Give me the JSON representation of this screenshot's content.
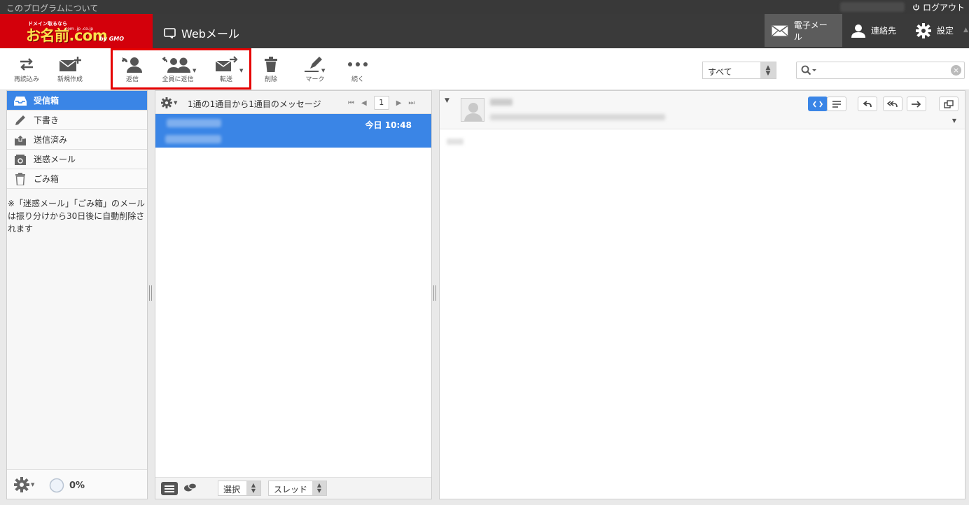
{
  "topbar": {
    "about": "このプログラムについて",
    "logout": "ログアウト"
  },
  "logo": {
    "small": "ドメイン取るなら",
    "main": "お名前.com",
    "tlds": ".com .jp .co.jp",
    "gmo": "by GMO"
  },
  "app": {
    "title": "Webメール"
  },
  "nav": {
    "mail": "電子メール",
    "contacts": "連絡先",
    "settings": "設定"
  },
  "toolbar": {
    "refresh": "再読込み",
    "compose": "新規作成",
    "reply": "返信",
    "reply_all": "全員に返信",
    "forward": "転送",
    "delete": "削除",
    "mark": "マーク",
    "more": "続く"
  },
  "filter": {
    "selected": "すべて"
  },
  "search": {
    "placeholder": ""
  },
  "folders": [
    {
      "label": "受信箱",
      "icon": "inbox-icon",
      "active": true
    },
    {
      "label": "下書き",
      "icon": "pencil-icon"
    },
    {
      "label": "送信済み",
      "icon": "sent-icon"
    },
    {
      "label": "迷惑メール",
      "icon": "junk-icon"
    },
    {
      "label": "ごみ箱",
      "icon": "trash-icon"
    }
  ],
  "folder_note": "※「迷惑メール」「ごみ箱」のメールは振り分けから30日後に自動削除されます",
  "quota": "0%",
  "list": {
    "count": "1通の1通目から1通目のメッセージ",
    "page": "1",
    "messages": [
      {
        "date": "今日 10:48"
      }
    ],
    "select_label": "選択",
    "thread_label": "スレッド"
  },
  "colors": {
    "accent": "#3a85e6",
    "brand_red": "#d3000b",
    "header_dark": "#3a3a3a"
  }
}
